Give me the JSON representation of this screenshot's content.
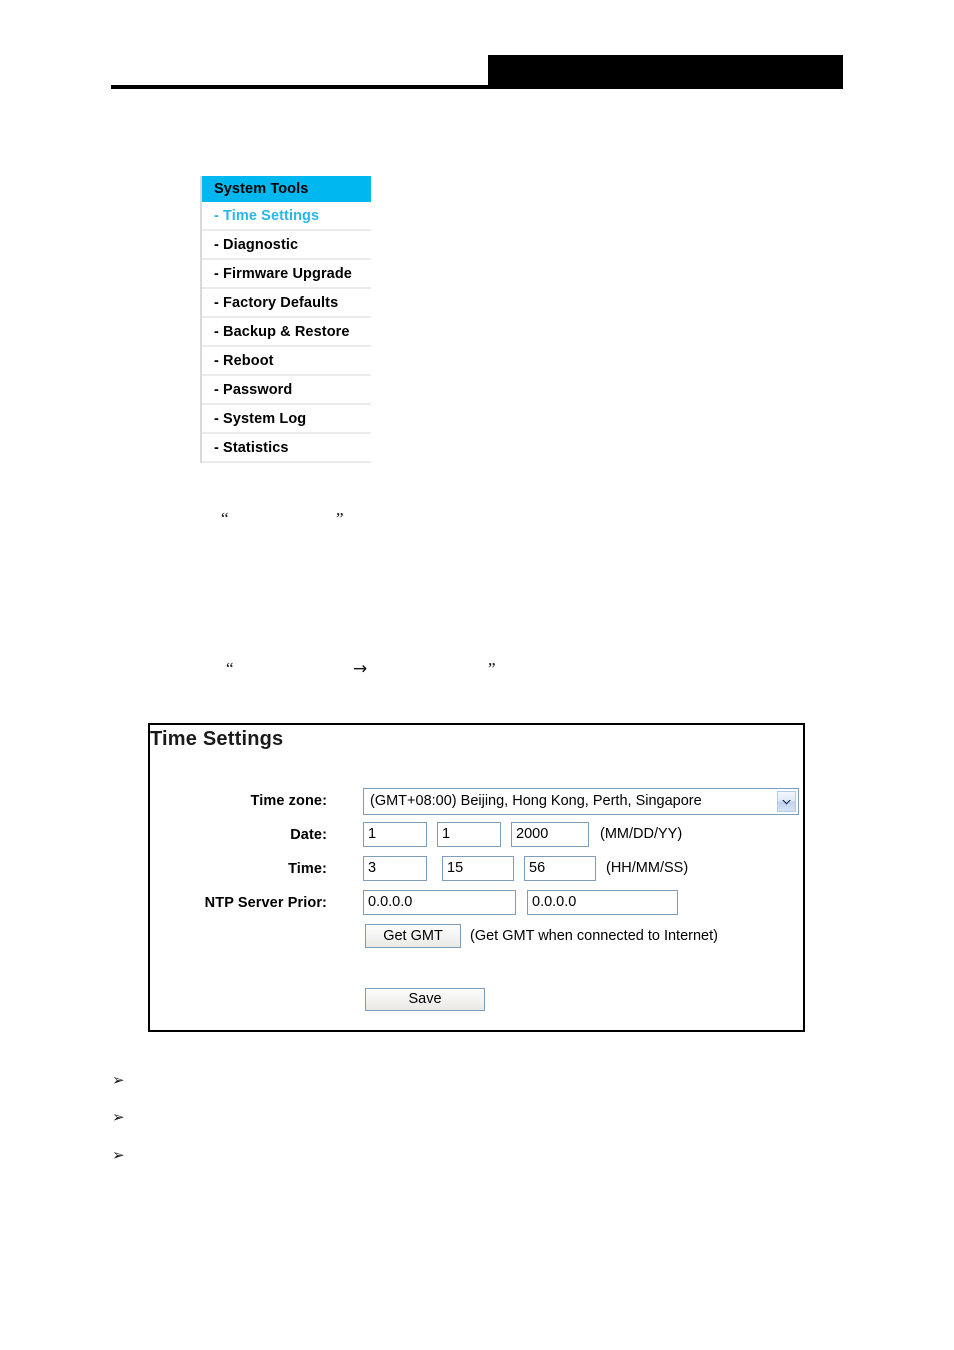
{
  "header": {
    "redaction_color": "#000000",
    "rule_color": "#000000"
  },
  "sidebar": {
    "heading": "System Tools",
    "heading_bg": "#00b7ef",
    "active_color": "#29b6e8",
    "items": [
      {
        "label": "- Time Settings",
        "active": true
      },
      {
        "label": "- Diagnostic",
        "active": false
      },
      {
        "label": "- Firmware Upgrade",
        "active": false
      },
      {
        "label": "- Factory Defaults",
        "active": false
      },
      {
        "label": "- Backup & Restore",
        "active": false
      },
      {
        "label": "- Reboot",
        "active": false
      },
      {
        "label": "- Password",
        "active": false
      },
      {
        "label": "- System Log",
        "active": false
      },
      {
        "label": "- Statistics",
        "active": false
      }
    ]
  },
  "body_marks": {
    "quote_open": "“",
    "quote_close": "”",
    "arrow": "→",
    "bullet": "➢"
  },
  "panel": {
    "title": "Time Settings",
    "rows": {
      "timezone": {
        "label": "Time zone:",
        "value": "(GMT+08:00) Beijing, Hong Kong, Perth, Singapore"
      },
      "date": {
        "label": "Date:",
        "month": "1",
        "day": "1",
        "year": "2000",
        "format_hint": "(MM/DD/YY)"
      },
      "time": {
        "label": "Time:",
        "hour": "3",
        "minute": "15",
        "second": "56",
        "format_hint": "(HH/MM/SS)"
      },
      "ntp": {
        "label": "NTP Server Prior:",
        "primary": "0.0.0.0",
        "secondary": "0.0.0.0"
      }
    },
    "get_gmt_button": "Get GMT",
    "get_gmt_note": "(Get GMT when connected to Internet)",
    "save_button": "Save"
  }
}
